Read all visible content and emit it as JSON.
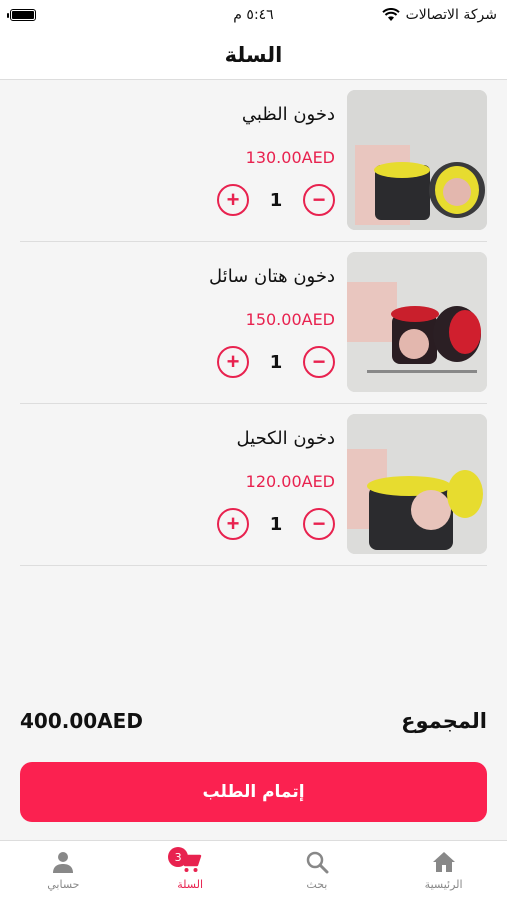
{
  "status_bar": {
    "carrier": "شركة الاتصالات",
    "time": "٥:٤٦ م"
  },
  "header": {
    "title": "السلة"
  },
  "cart": {
    "items": [
      {
        "name": "دخون الظبي",
        "price": "130.00AED",
        "quantity": "1"
      },
      {
        "name": "دخون هتان سائل",
        "price": "150.00AED",
        "quantity": "1"
      },
      {
        "name": "دخون الكحيل",
        "price": "120.00AED",
        "quantity": "1"
      }
    ],
    "plus_symbol": "+",
    "minus_symbol": "−"
  },
  "summary": {
    "total_label": "المجموع",
    "total_value": "400.00AED"
  },
  "checkout": {
    "label": "إتمام الطلب"
  },
  "tabs": [
    {
      "label": "الرئيسية",
      "icon": "home-icon"
    },
    {
      "label": "بحث",
      "icon": "search-icon"
    },
    {
      "label": "السلة",
      "icon": "cart-icon",
      "badge": "3"
    },
    {
      "label": "حسابي",
      "icon": "user-icon"
    }
  ],
  "colors": {
    "accent": "#e8224f",
    "button": "#fb2150"
  }
}
